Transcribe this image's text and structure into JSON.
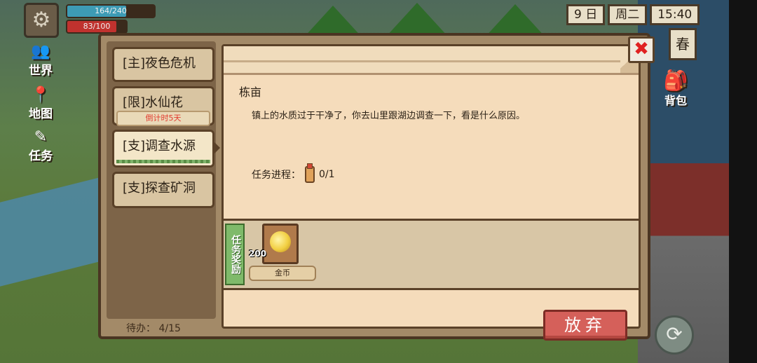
{
  "hud": {
    "hp_text": "164/240",
    "hp_fraction": 0.68,
    "energy_text": "83/100",
    "energy_fraction": 0.83
  },
  "side_nav": [
    {
      "label": "世界",
      "icon": "people-icon"
    },
    {
      "label": "地图",
      "icon": "map-pin-icon"
    },
    {
      "label": "任务",
      "icon": "quill-icon"
    }
  ],
  "date": {
    "day": "9 日",
    "weekday": "周二",
    "time": "15:40",
    "season": "春"
  },
  "bag_label": "背包",
  "quests": [
    {
      "label": "[主]夜色危机"
    },
    {
      "label": "[限]水仙花",
      "badge": "倒计时5天"
    },
    {
      "label": "[支]调查水源"
    },
    {
      "label": "[支]探查矿洞"
    }
  ],
  "todo": "待办：  4/15",
  "detail": {
    "title": "栋亩",
    "description": "镇上的水质过于干净了，你去山里跟湖边调查一下，看是什么原因。",
    "progress_label": "任务进程：",
    "progress_value": "0/1",
    "reward_tag": "任务奖励",
    "reward": {
      "count": "200",
      "name": "金币",
      "icon": "gold-coin-icon"
    },
    "abandon_label": "放弃"
  },
  "colors": {
    "hp": "#3d9bb5",
    "energy": "#c0322e",
    "accent_red": "#d5605a",
    "reward_green": "#7fba6a"
  }
}
